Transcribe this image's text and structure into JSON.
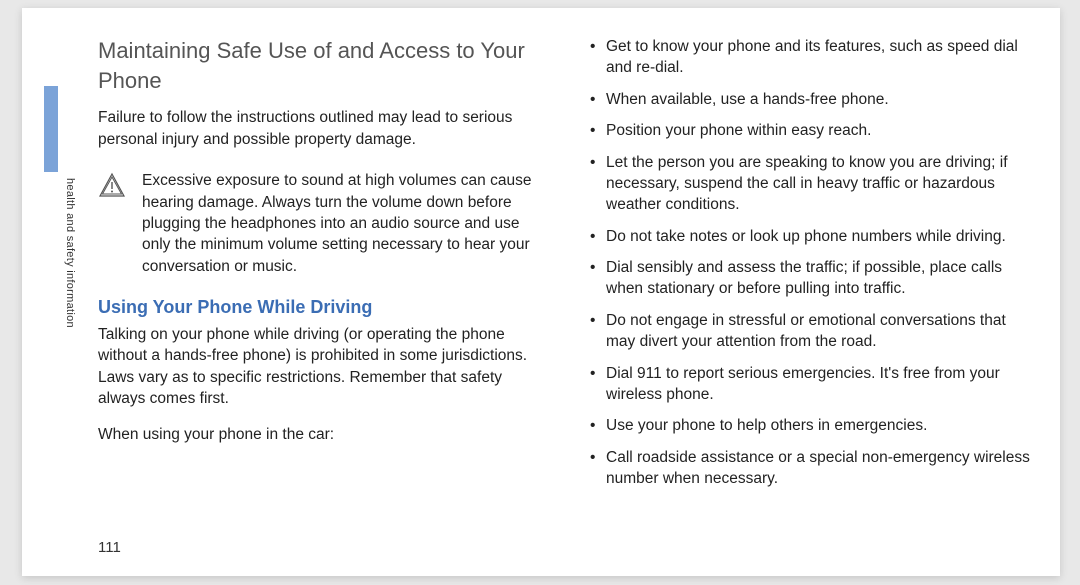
{
  "sidebar": {
    "vertical_label": "health and safety information"
  },
  "left": {
    "heading": "Maintaining Safe Use of and Access to Your Phone",
    "intro": "Failure to follow the instructions outlined may lead to serious personal injury and possible property damage.",
    "warning": "Excessive exposure to sound at high volumes can cause hearing damage. Always turn the volume down before plugging the headphones into an audio source and use only the minimum volume setting necessary to hear your conversation or music.",
    "subheading": "Using Your Phone While Driving",
    "driving_para": "Talking on your phone while driving (or operating the phone without a hands-free phone) is prohibited in some jurisdictions. Laws vary as to specific restrictions. Remember that safety always comes first.",
    "list_intro": "When using your phone in the car:"
  },
  "right": {
    "bullets": [
      "Get to know your phone and its features, such as speed dial and re-dial.",
      "When available, use a hands-free phone.",
      "Position your phone within easy reach.",
      "Let the person you are speaking to know you are driving; if necessary, suspend the call in heavy traffic or hazardous weather conditions.",
      "Do not take notes or look up phone numbers while driving.",
      "Dial sensibly and assess the traffic; if possible, place calls when stationary or before pulling into traffic.",
      "Do not engage in stressful or emotional conversations that may divert your attention from the road.",
      "Dial 911 to report serious emergencies. It's free from your wireless phone.",
      "Use your phone to help others in emergencies.",
      "Call roadside assistance or a special non-emergency wireless number when necessary."
    ]
  },
  "page_number": "111"
}
